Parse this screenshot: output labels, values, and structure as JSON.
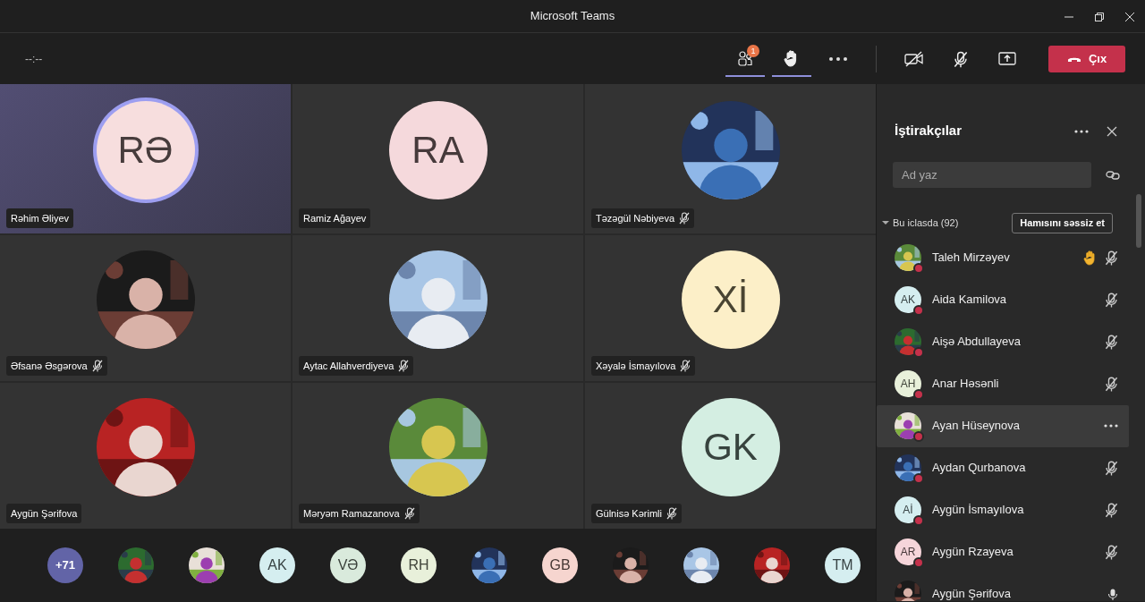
{
  "window": {
    "title": "Microsoft Teams"
  },
  "toolbar": {
    "timer": "--:--",
    "participants_badge": "1",
    "participants_selected": true,
    "hand_selected": true,
    "leave_label": "Çıx"
  },
  "tiles": [
    {
      "name": "Rəhim Əliyev",
      "avatar": {
        "kind": "initials",
        "text": "RƏ",
        "color": "#f7dede"
      },
      "muted": false,
      "speaking": true
    },
    {
      "name": "Ramiz Ağayev",
      "avatar": {
        "kind": "initials",
        "text": "RA",
        "color": "#f5d9dc"
      },
      "muted": false,
      "speaking": false
    },
    {
      "name": "Təzəgül Nəbiyeva",
      "avatar": {
        "kind": "picture"
      },
      "muted": true,
      "speaking": false
    },
    {
      "name": "Əfsanə Əsgərova",
      "avatar": {
        "kind": "picture"
      },
      "muted": true,
      "speaking": false
    },
    {
      "name": "Aytac Allahverdiyeva",
      "avatar": {
        "kind": "picture"
      },
      "muted": true,
      "speaking": false
    },
    {
      "name": "Xəyalə İsmayılova",
      "avatar": {
        "kind": "initials",
        "text": "Xİ",
        "color": "#fcefc8"
      },
      "muted": true,
      "speaking": false
    },
    {
      "name": "Aygün Şərifova",
      "avatar": {
        "kind": "picture"
      },
      "muted": false,
      "speaking": false
    },
    {
      "name": "Məryəm Ramazanova",
      "avatar": {
        "kind": "picture"
      },
      "muted": true,
      "speaking": false
    },
    {
      "name": "Gülnisə Kərimli",
      "avatar": {
        "kind": "initials",
        "text": "GK",
        "color": "#d4eee2"
      },
      "muted": true,
      "speaking": false
    }
  ],
  "strip": {
    "overflow": "+71",
    "avatars": [
      {
        "kind": "picture"
      },
      {
        "kind": "picture"
      },
      {
        "kind": "initials",
        "text": "AK",
        "color": "#d5eef0"
      },
      {
        "kind": "initials",
        "text": "VƏ",
        "color": "#d9eadc"
      },
      {
        "kind": "initials",
        "text": "RH",
        "color": "#e8f0da"
      },
      {
        "kind": "picture"
      },
      {
        "kind": "initials",
        "text": "GB",
        "color": "#f6d5cf"
      },
      {
        "kind": "picture"
      },
      {
        "kind": "picture"
      },
      {
        "kind": "picture"
      },
      {
        "kind": "initials",
        "text": "TM",
        "color": "#d5eef0"
      }
    ]
  },
  "panel": {
    "title": "İştirakçılar",
    "search": {
      "placeholder": "Ad yaz"
    },
    "section": {
      "label": "Bu iclasda (92)",
      "expanded": true,
      "mute_all": "Hamısını səssiz et"
    },
    "participants": [
      {
        "name": "Taleh Mirzəyev",
        "avatar": {
          "kind": "picture"
        },
        "hand_raised": true,
        "muted": true,
        "selected": false
      },
      {
        "name": "Aida Kamilova",
        "avatar": {
          "kind": "initials",
          "text": "AK",
          "color": "#d5eef0"
        },
        "hand_raised": false,
        "muted": true,
        "selected": false
      },
      {
        "name": "Aişə Abdullayeva",
        "avatar": {
          "kind": "picture"
        },
        "hand_raised": false,
        "muted": true,
        "selected": false
      },
      {
        "name": "Anar Həsənli",
        "avatar": {
          "kind": "initials",
          "text": "AH",
          "color": "#e8f0da"
        },
        "hand_raised": false,
        "muted": true,
        "selected": false
      },
      {
        "name": "Ayan Hüseynova",
        "avatar": {
          "kind": "picture"
        },
        "hand_raised": false,
        "selected": true
      },
      {
        "name": "Aydan Qurbanova",
        "avatar": {
          "kind": "picture"
        },
        "hand_raised": false,
        "muted": true,
        "selected": false
      },
      {
        "name": "Aygün İsmayılova",
        "avatar": {
          "kind": "initials",
          "text": "Aİ",
          "color": "#d5eef0"
        },
        "hand_raised": false,
        "muted": true,
        "selected": false
      },
      {
        "name": "Aygün Rzayeva",
        "avatar": {
          "kind": "initials",
          "text": "AR",
          "color": "#f6d5da"
        },
        "hand_raised": false,
        "muted": true,
        "selected": false
      },
      {
        "name": "Aygün Şərifova",
        "avatar": {
          "kind": "picture"
        },
        "hand_raised": false,
        "muted": false,
        "selected": false
      }
    ]
  }
}
